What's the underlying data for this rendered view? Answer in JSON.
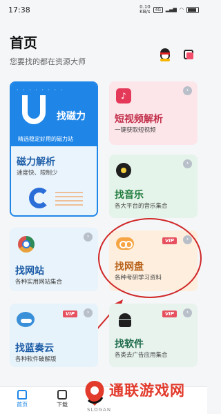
{
  "status": {
    "time": "17:38",
    "speed": "0.10\nKB/s",
    "network": "4G",
    "battery": ""
  },
  "header": {
    "title": "首页",
    "subtitle": "您要找的都在资源大师"
  },
  "cards": {
    "magnet": {
      "banner_label": "找磁力",
      "banner_tag": "精选稳定好用的磁力站",
      "title": "磁力解析",
      "desc": "速度快、限制少"
    },
    "shortvideo": {
      "title": "短视频解析",
      "desc": "一键获取短视频"
    },
    "music": {
      "title": "找音乐",
      "desc": "各大平台的音乐集合"
    },
    "website": {
      "title": "找网站",
      "desc": "各种实用网站集合"
    },
    "netdisk": {
      "title": "找网盘",
      "desc": "各种考研学习资料",
      "badge": "VIP"
    },
    "lanzou": {
      "title": "找蓝奏云",
      "desc": "各种软件破解版",
      "badge": "VIP"
    },
    "software": {
      "title": "找软件",
      "desc": "各类去广告应用集合",
      "badge": "VIP"
    }
  },
  "nav": {
    "home": "首页",
    "download": "下载"
  },
  "watermark": {
    "text": "通联游戏网",
    "slogan": "SLOGAN"
  },
  "colors": {
    "accent": "#1f86e8",
    "highlight": "#d02828",
    "vip": "#e6505f"
  }
}
